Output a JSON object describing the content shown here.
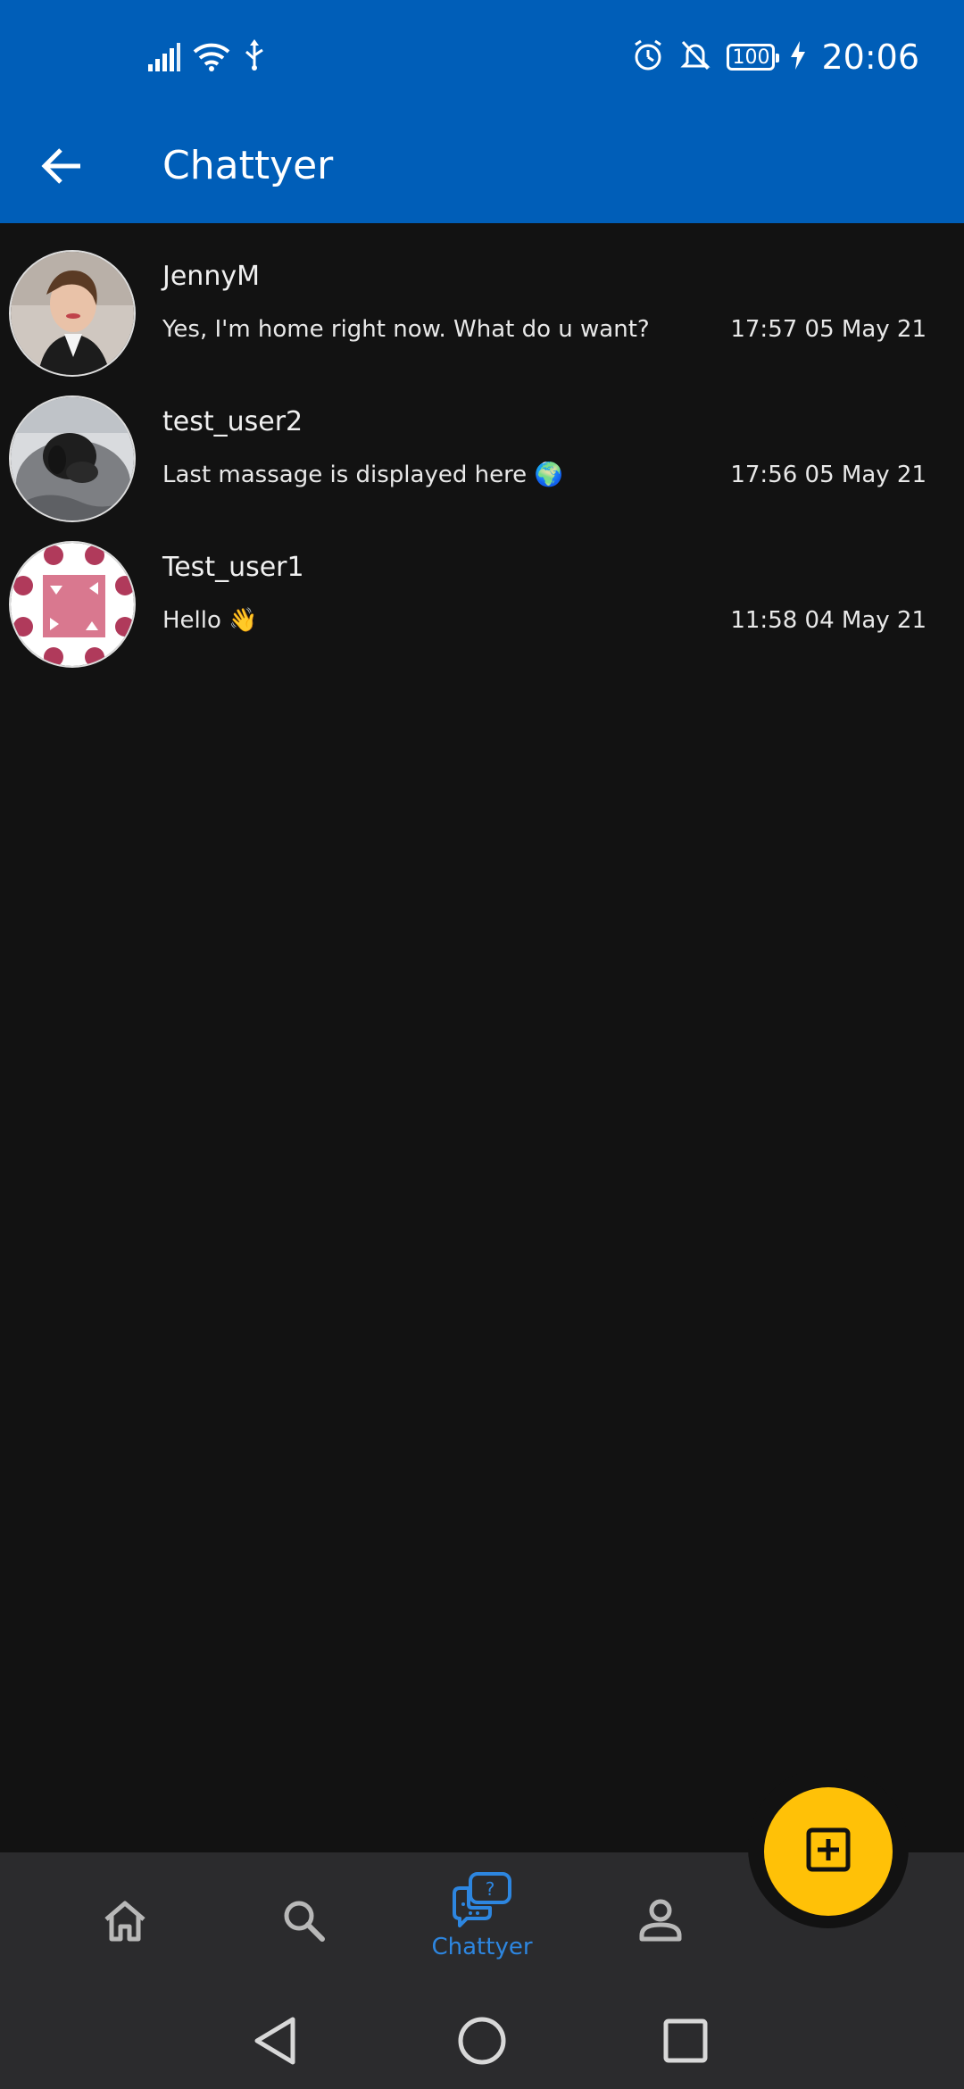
{
  "status_bar": {
    "time": "20:06",
    "battery": "100",
    "icons": [
      "signal-icon",
      "wifi-icon",
      "usb-icon",
      "alarm-icon",
      "mute-icon",
      "battery-icon",
      "charging-icon"
    ]
  },
  "app_bar": {
    "title": "Chattyer",
    "back_icon": "back-arrow-icon"
  },
  "chats": [
    {
      "name": "JennyM",
      "message": "Yes, I'm home right now. What do u want?",
      "time": "17:57 05 May 21"
    },
    {
      "name": "test_user2",
      "message": "Last massage is displayed here 🌍",
      "time": "17:56 05 May 21"
    },
    {
      "name": "Test_user1",
      "message": "Hello 👋",
      "time": "11:58 04 May 21"
    }
  ],
  "bottom_nav": {
    "items": [
      {
        "icon": "home-icon"
      },
      {
        "icon": "search-icon"
      },
      {
        "icon": "chat-bubbles-icon",
        "label": "Chattyer",
        "active": true
      },
      {
        "icon": "profile-icon"
      }
    ],
    "fab_icon": "add-square-icon"
  },
  "colors": {
    "primary": "#005EB8",
    "background": "#121212",
    "accent": "#FFC107",
    "active_nav": "#2d86e0",
    "nav_bg": "#2b2b2d"
  }
}
